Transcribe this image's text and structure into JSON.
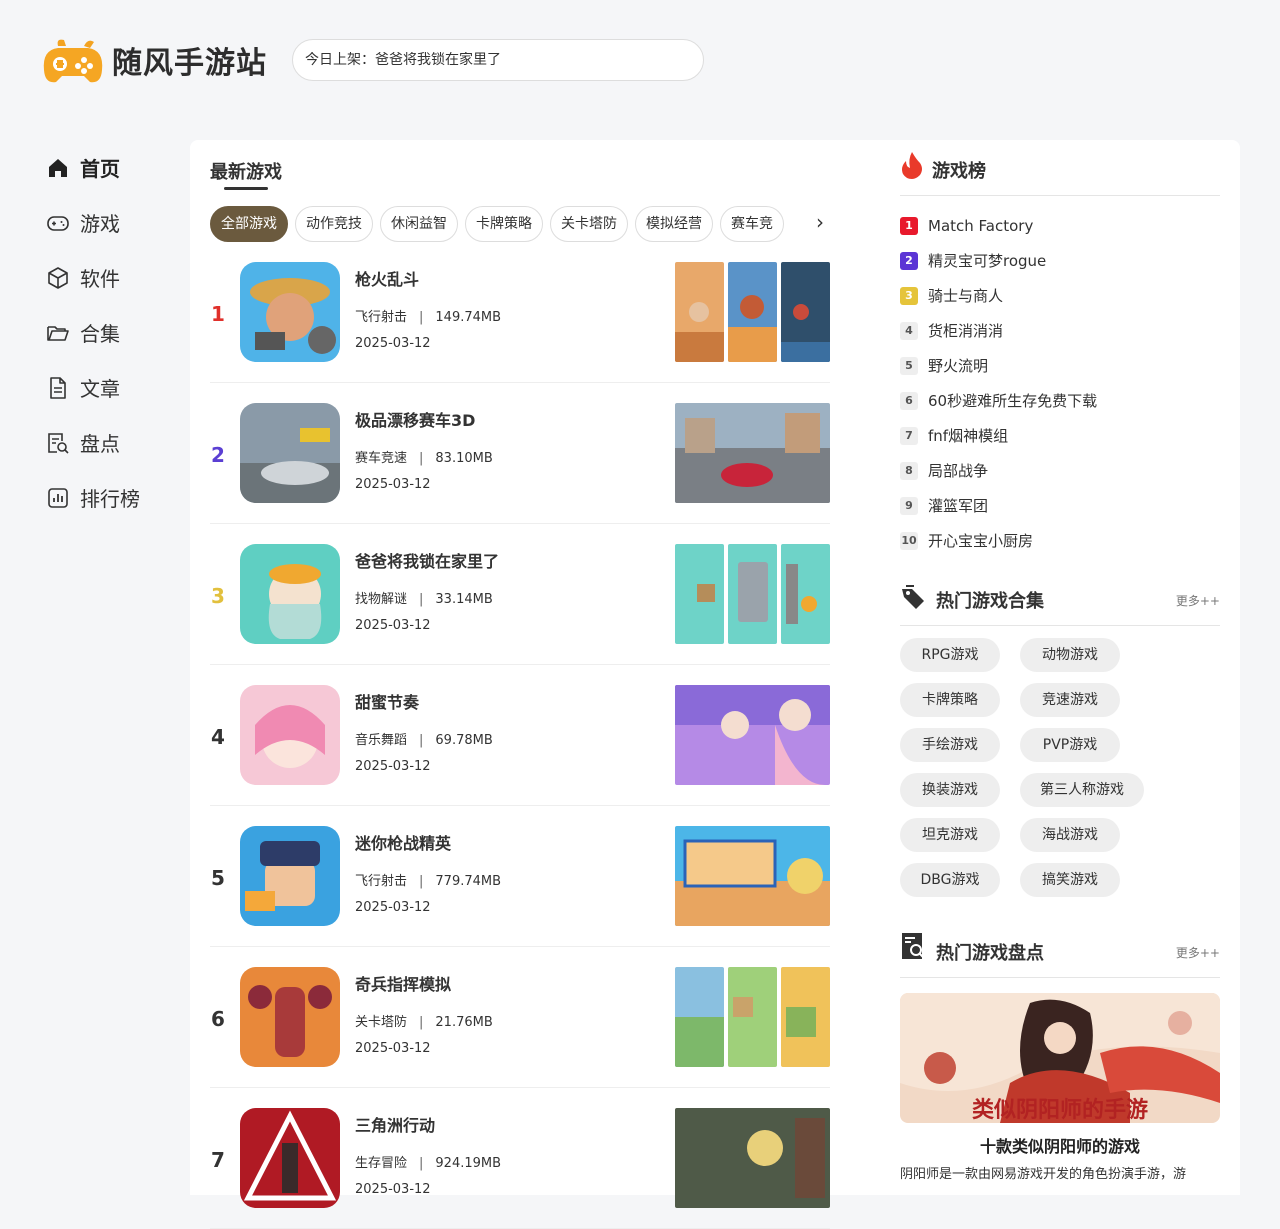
{
  "site": {
    "logo_text": "随风手游站"
  },
  "search": {
    "placeholder": "今日上架：爸爸将我锁在家里了"
  },
  "nav": [
    {
      "label": "首页",
      "icon": "home-icon",
      "active": true
    },
    {
      "label": "游戏",
      "icon": "gamepad-icon"
    },
    {
      "label": "软件",
      "icon": "cube-icon"
    },
    {
      "label": "合集",
      "icon": "folder-icon"
    },
    {
      "label": "文章",
      "icon": "document-icon"
    },
    {
      "label": "盘点",
      "icon": "search-doc-icon"
    },
    {
      "label": "排行榜",
      "icon": "chart-icon"
    }
  ],
  "latest": {
    "title": "最新游戏",
    "tabs": [
      "全部游戏",
      "动作竞技",
      "休闲益智",
      "卡牌策略",
      "关卡塔防",
      "模拟经营",
      "赛车竞"
    ],
    "games": [
      {
        "rank": "1",
        "name": "枪火乱斗",
        "category": "飞行射击",
        "size": "149.74MB",
        "date": "2025-03-12"
      },
      {
        "rank": "2",
        "name": "极品漂移赛车3D",
        "category": "赛车竞速",
        "size": "83.10MB",
        "date": "2025-03-12"
      },
      {
        "rank": "3",
        "name": "爸爸将我锁在家里了",
        "category": "找物解谜",
        "size": "33.14MB",
        "date": "2025-03-12"
      },
      {
        "rank": "4",
        "name": "甜蜜节奏",
        "category": "音乐舞蹈",
        "size": "69.78MB",
        "date": "2025-03-12"
      },
      {
        "rank": "5",
        "name": "迷你枪战精英",
        "category": "飞行射击",
        "size": "779.74MB",
        "date": "2025-03-12"
      },
      {
        "rank": "6",
        "name": "奇兵指挥模拟",
        "category": "关卡塔防",
        "size": "21.76MB",
        "date": "2025-03-12"
      },
      {
        "rank": "7",
        "name": "三角洲行动",
        "category": "生存冒险",
        "size": "924.19MB",
        "date": "2025-03-12"
      }
    ],
    "sep": "|",
    "rank_colors": [
      "#e0302b",
      "#5b3fd3",
      "#e2c03d",
      "#333333",
      "#333333",
      "#333333",
      "#333333"
    ]
  },
  "chart": {
    "title": "游戏榜",
    "items": [
      {
        "n": "1",
        "name": "Match Factory"
      },
      {
        "n": "2",
        "name": "精灵宝可梦rogue"
      },
      {
        "n": "3",
        "name": "骑士与商人"
      },
      {
        "n": "4",
        "name": "货柜消消消"
      },
      {
        "n": "5",
        "name": "野火流明"
      },
      {
        "n": "6",
        "name": "60秒避难所生存免费下载"
      },
      {
        "n": "7",
        "name": "fnf烟神模组"
      },
      {
        "n": "8",
        "name": "局部战争"
      },
      {
        "n": "9",
        "name": "灌篮军团"
      },
      {
        "n": "10",
        "name": "开心宝宝小厨房"
      }
    ],
    "badge_colors": [
      "#e8192c",
      "#5b35d5",
      "#e5c43a"
    ]
  },
  "collections": {
    "title": "热门游戏合集",
    "more": "更多++",
    "tags": [
      "RPG游戏",
      "动物游戏",
      "卡牌策略",
      "竞速游戏",
      "手绘游戏",
      "PVP游戏",
      "换装游戏",
      "第三人称游戏",
      "坦克游戏",
      "海战游戏",
      "DBG游戏",
      "搞笑游戏"
    ]
  },
  "roundup": {
    "title": "热门游戏盘点",
    "more": "更多++",
    "feature_title": "十款类似阴阳师的游戏",
    "feature_desc": "阴阳师是一款由网易游戏开发的角色扮演手游，游",
    "banner_text": "类似阴阳师的手游"
  }
}
